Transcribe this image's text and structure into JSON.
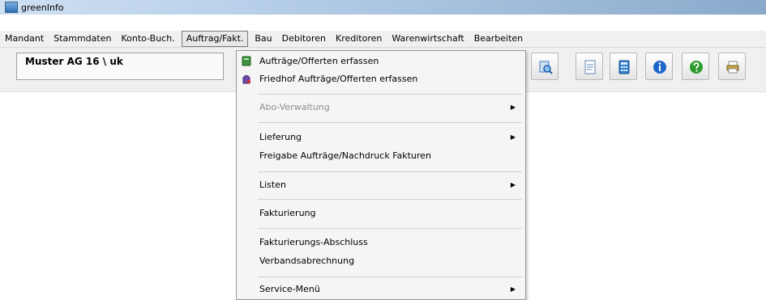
{
  "window": {
    "title": "greenInfo"
  },
  "menubar": {
    "items": [
      "Mandant",
      "Stammdaten",
      "Konto-Buch.",
      "Auftrag/Fakt.",
      "Bau",
      "Debitoren",
      "Kreditoren",
      "Warenwirtschaft",
      "Bearbeiten"
    ]
  },
  "toolbar": {
    "company": "Muster AG 16 \\ uk",
    "buttons": [
      {
        "icon": "search-document-icon",
        "color": "#3c7cc4"
      },
      {
        "icon": "document-icon",
        "color": "#5f84b4"
      },
      {
        "icon": "calculator-icon",
        "color": "#2f7fd0"
      },
      {
        "icon": "info-icon",
        "color": "#1e66c9"
      },
      {
        "icon": "help-icon",
        "color": "#2e9b2e"
      },
      {
        "icon": "printer-icon",
        "color": "#c7a24a"
      }
    ]
  },
  "dropdown": {
    "items": {
      "auftraege": "Aufträge/Offerten erfassen",
      "friedhof": "Friedhof Aufträge/Offerten erfassen",
      "abo": "Abo-Verwaltung",
      "lieferung": "Lieferung",
      "freigabe": "Freigabe Aufträge/Nachdruck Fakturen",
      "listen": "Listen",
      "fakturierung": "Fakturierung",
      "abschluss": "Fakturierungs-Abschluss",
      "verband": "Verbandsabrechnung",
      "service": "Service-Menü"
    },
    "submenu_arrow": "▶"
  }
}
